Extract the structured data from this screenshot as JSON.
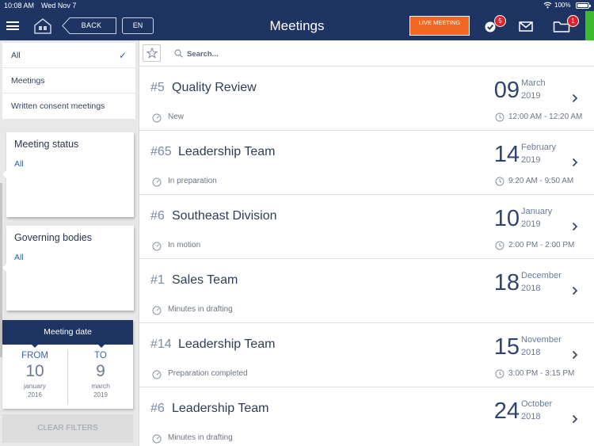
{
  "status_bar": {
    "time": "10:08 AM",
    "date": "Wed Nov 7",
    "battery": "100%"
  },
  "header": {
    "back_label": "BACK",
    "language": "EN",
    "title": "Meetings",
    "live_meeting_label": "LIVE MEETING",
    "tasks_badge": "5",
    "files_badge": "1"
  },
  "sidebar": {
    "types": [
      {
        "label": "All",
        "selected": true
      },
      {
        "label": "Meetings",
        "selected": false
      },
      {
        "label": "Written consent meetings",
        "selected": false
      }
    ],
    "meeting_status": {
      "title": "Meeting status",
      "value": "All"
    },
    "governing_bodies": {
      "title": "Governing bodies",
      "value": "All"
    },
    "meeting_date": {
      "title": "Meeting date",
      "from": {
        "label": "FROM",
        "day": "10",
        "month": "january",
        "year": "2016"
      },
      "to": {
        "label": "TO",
        "day": "9",
        "month": "march",
        "year": "2019"
      }
    },
    "clear_filters_label": "CLEAR FILTERS"
  },
  "search": {
    "placeholder": "Search..."
  },
  "meetings": [
    {
      "number": "#5",
      "name": "Quality Review",
      "status": "New",
      "day": "09",
      "month": "March",
      "year": "2019",
      "time": "12:00 AM - 12:20 AM"
    },
    {
      "number": "#65",
      "name": "Leadership Team",
      "status": "In preparation",
      "day": "14",
      "month": "February",
      "year": "2019",
      "time": "9:20 AM - 9:50 AM"
    },
    {
      "number": "#6",
      "name": "Southeast Division",
      "status": "In motion",
      "day": "10",
      "month": "January",
      "year": "2019",
      "time": "2:00 PM - 2:00 PM"
    },
    {
      "number": "#1",
      "name": "Sales Team",
      "status": "Minutes in drafting",
      "day": "18",
      "month": "December",
      "year": "2018",
      "time": ""
    },
    {
      "number": "#14",
      "name": "Leadership Team",
      "status": "Preparation completed",
      "day": "15",
      "month": "November",
      "year": "2018",
      "time": "3:00 PM - 3:15 PM"
    },
    {
      "number": "#6",
      "name": "Leadership Team",
      "status": "Minutes in drafting",
      "day": "24",
      "month": "October",
      "year": "2018",
      "time": ""
    }
  ],
  "colors": {
    "header": "#1e3563",
    "live_button": "#f26722",
    "badge": "#d9252b",
    "accent": "#3a65b0"
  }
}
